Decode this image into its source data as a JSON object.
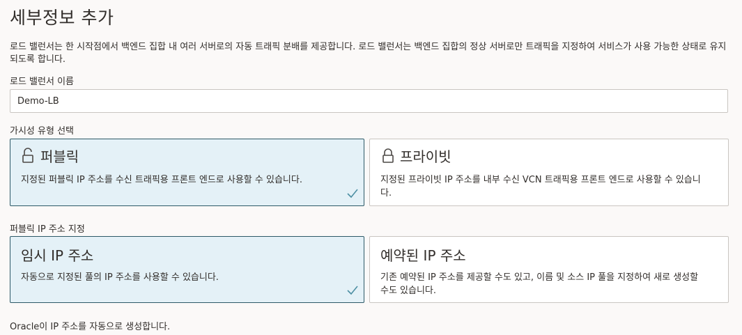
{
  "page": {
    "title": "세부정보 추가",
    "description": "로드 밸런서는 한 시작점에서 백엔드 집합 내 여러 서버로의 자동 트래픽 분배를 제공합니다. 로드 밸런서는 백엔드 집합의 정상 서버로만 트래픽을 지정하여 서비스가 사용 가능한 상태로 유지되도록 합니다."
  },
  "name_field": {
    "label": "로드 밸런서 이름",
    "value": "Demo-LB"
  },
  "visibility": {
    "label": "가시성 유형 선택",
    "options": [
      {
        "title": "퍼블릭",
        "description": "지정된 퍼블릭 IP 주소를 수신 트래픽용 프론트 엔드로 사용할 수 있습니다.",
        "selected": true,
        "icon": "unlock-icon"
      },
      {
        "title": "프라이빗",
        "description": "지정된 프라이빗 IP 주소를 내부 수신 VCN 트래픽용 프론트 엔드로 사용할 수 있습니다.",
        "selected": false,
        "icon": "lock-icon"
      }
    ]
  },
  "ip_assign": {
    "label": "퍼블릭 IP 주소 지정",
    "options": [
      {
        "title": "임시 IP 주소",
        "description": "자동으로 지정된 풀의 IP 주소를 사용할 수 있습니다.",
        "selected": true
      },
      {
        "title": "예약된 IP 주소",
        "description": "기존 예약된 IP 주소를 제공할 수도 있고, 이름 및 소스 IP 풀을 지정하여 새로 생성할 수도 있습니다.",
        "selected": false
      }
    ]
  },
  "footer": {
    "text": "Oracle이 IP 주소를 자동으로 생성합니다."
  },
  "colors": {
    "selected_bg": "#e4f1f7",
    "selected_border": "#2c5967",
    "check": "#4d8fa3"
  }
}
